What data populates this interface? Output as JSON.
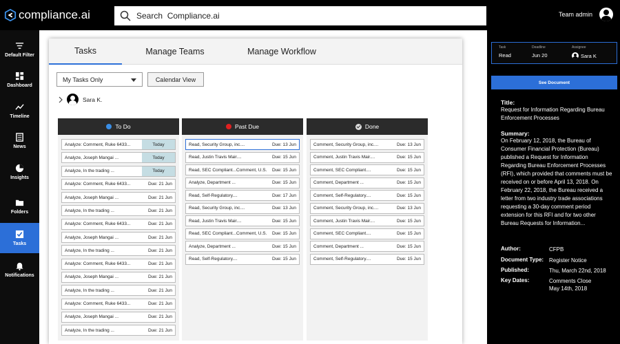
{
  "app": {
    "logo_text": "compliance.ai"
  },
  "search": {
    "placeholder": "Search  Compliance.ai"
  },
  "user": {
    "name": "Team admin"
  },
  "sidebar": {
    "items": [
      {
        "label": "Default Filter",
        "icon": "filter-icon"
      },
      {
        "label": "Dashboard",
        "icon": "dashboard-icon"
      },
      {
        "label": "Timeline",
        "icon": "timeline-icon"
      },
      {
        "label": "News",
        "icon": "news-icon"
      },
      {
        "label": "Insights",
        "icon": "pie-chart-icon"
      },
      {
        "label": "Folders",
        "icon": "folder-icon"
      },
      {
        "label": "Tasks",
        "icon": "checkbox-icon",
        "active": true
      },
      {
        "label": "Notifications",
        "icon": "bell-icon"
      }
    ]
  },
  "tabs": [
    "Tasks",
    "Manage Teams",
    "Manage Workflow"
  ],
  "filter": {
    "selected": "My Tasks Only"
  },
  "calendar_button": "Calendar View",
  "assignee": {
    "name": "Sara K."
  },
  "columns": {
    "todo": {
      "title": "To Do",
      "color": "#3a8ee6",
      "cards": [
        {
          "title": "Analyze: Comment, Ruke 6433...",
          "due": "Today"
        },
        {
          "title": "Analyze, Joseph Mangai ...",
          "due": "Today"
        },
        {
          "title": "Analyze, In the trading ...",
          "due": "Today"
        },
        {
          "title": "Analyze: Comment, Ruke 6433...",
          "due": "Due: 21 Jun"
        },
        {
          "title": "Analyze, Joseph Mangai ...",
          "due": "Due: 21 Jun"
        },
        {
          "title": "Analyze, In the trading ...",
          "due": "Due: 21 Jun"
        },
        {
          "title": "Analyze: Comment, Ruke 6433...",
          "due": "Due: 21 Jun"
        },
        {
          "title": "Analyze, Joseph Mangai ...",
          "due": "Due: 21 Jun"
        },
        {
          "title": "Analyze, In the trading ...",
          "due": "Due: 21 Jun"
        },
        {
          "title": "Analyze: Comment, Ruke 6433...",
          "due": "Due: 21 Jun"
        },
        {
          "title": "Analyze, Joseph Mangai ...",
          "due": "Due: 21 Jun"
        },
        {
          "title": "Analyze, In the trading ...",
          "due": "Due: 21 Jun"
        },
        {
          "title": "Analyze: Comment, Ruke 6433...",
          "due": "Due: 21 Jun"
        },
        {
          "title": "Analyze, Joseph Mangai ...",
          "due": "Due: 21 Jun"
        },
        {
          "title": "Analyze, In the trading ...",
          "due": "Due: 21 Jun"
        }
      ]
    },
    "past": {
      "title": "Past Due",
      "color": "#e02020",
      "cards": [
        {
          "title": "Read, Security Group, inc....",
          "due": "Due: 13 Jun"
        },
        {
          "title": "Read, Justin Travis Mair....",
          "due": "Due: 15 Jun"
        },
        {
          "title": "Read, SEC Compliant...Comment, U.S.",
          "due": "Due: 15 Jun"
        },
        {
          "title": "Analyze, Department ...",
          "due": "Due: 15 Jun"
        },
        {
          "title": "Read, Self-Regulatory....",
          "due": "Due: 17 Jun"
        },
        {
          "title": "Read, Security Group, inc....",
          "due": "Due: 13 Jun"
        },
        {
          "title": "Read, Justin Travis Mair....",
          "due": "Due: 15 Jun"
        },
        {
          "title": "Read, SEC Compliant...Comment, U.S.",
          "due": "Due: 15 Jun"
        },
        {
          "title": "Analyze, Department ...",
          "due": "Due: 15 Jun"
        },
        {
          "title": "Read, Self-Regulatory....",
          "due": "Due: 15 Jun"
        }
      ]
    },
    "done": {
      "title": "Done",
      "cards": [
        {
          "title": "Comment, Security Group, inc....",
          "due": "Due: 13 Jun"
        },
        {
          "title": "Comment, Justin Travis Mair....",
          "due": "Due: 15 Jun"
        },
        {
          "title": "Comment, SEC Compliant....",
          "due": "Due: 15 Jun"
        },
        {
          "title": "Comment, Department ...",
          "due": "Due: 15 Jun"
        },
        {
          "title": "Comment, Self-Regulatory....",
          "due": "Due: 15 Jun"
        },
        {
          "title": "Comment, Security Group, inc....",
          "due": "Due: 13 Jun"
        },
        {
          "title": "Comment, Justin Travis Mair....",
          "due": "Due: 15 Jun"
        },
        {
          "title": "Comment, SEC Compliant....",
          "due": "Due: 15 Jun"
        },
        {
          "title": "Comment, Department ...",
          "due": "Due: 15 Jun"
        },
        {
          "title": "Comment, Self-Regulatory....",
          "due": "Due: 15 Jun"
        }
      ]
    }
  },
  "detail": {
    "task": {
      "task_label": "Task",
      "task_value": "Read",
      "deadline_label": "Deadline",
      "deadline_value": "Jun 20",
      "assignee_label": "Assignee",
      "assignee_value": "Sara K"
    },
    "see_document": "See Document",
    "title_label": "Title:",
    "title": "Request for Information Regarding Bureau Enforcement Processes",
    "summary_label": "Summary:",
    "summary": "On February 12, 2018, the Bureau of Consumer Financial Protection (Bureau) published a Request for Information Regarding Bureau Enforcement Processes (RFI), which provided that comments must be received on or before April 13, 2018. On February 22, 2018, the Bureau received a letter from two industry trade associations requesting a 30-day comment period extension for this RFI and for two other Bureau Requests for Information...",
    "author_label": "Author:",
    "author": "CFPB",
    "doctype_label": "Document Type:",
    "doctype": "Register Notice",
    "published_label": "Published:",
    "published": "Thu, March 22nd, 2018",
    "keydates_label": "Key Dates:",
    "keydates": "Comments Close May 14th, 2018"
  }
}
